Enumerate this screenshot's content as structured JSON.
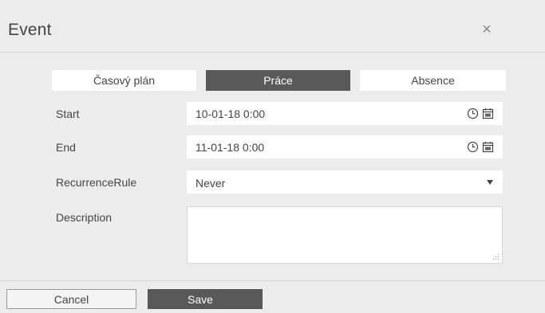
{
  "dialog": {
    "title": "Event",
    "close_symbol": "×"
  },
  "tabs": [
    {
      "label": "Časový plán",
      "active": false
    },
    {
      "label": "Práce",
      "active": true
    },
    {
      "label": "Absence",
      "active": false
    }
  ],
  "form": {
    "start": {
      "label": "Start",
      "value": "10-01-18 0:00"
    },
    "end": {
      "label": "End",
      "value": "11-01-18 0:00"
    },
    "recurrence": {
      "label": "RecurrenceRule",
      "value": "Never"
    },
    "description": {
      "label": "Description",
      "value": ""
    }
  },
  "footer": {
    "cancel_label": "Cancel",
    "save_label": "Save"
  },
  "icons": {
    "close": "close-icon",
    "clock": "clock-icon",
    "calendar": "calendar-icon",
    "dropdown": "chevron-down-icon",
    "resize": "resize-grip-icon"
  },
  "colors": {
    "dialog_bg": "#ececec",
    "active_tab": "#595959",
    "primary_button": "#595959"
  }
}
